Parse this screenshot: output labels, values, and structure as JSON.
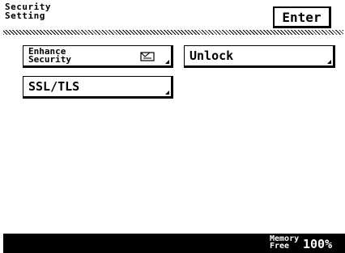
{
  "header": {
    "title": "Security\nSetting",
    "enter_label": "Enter"
  },
  "buttons": {
    "enhance_security": "Enhance\nSecurity",
    "enhance_icon": "document-icon",
    "unlock": "Unlock",
    "ssl_tls": "SSL/TLS"
  },
  "status": {
    "memory_label": "Memory\nFree",
    "memory_value": "100%"
  }
}
